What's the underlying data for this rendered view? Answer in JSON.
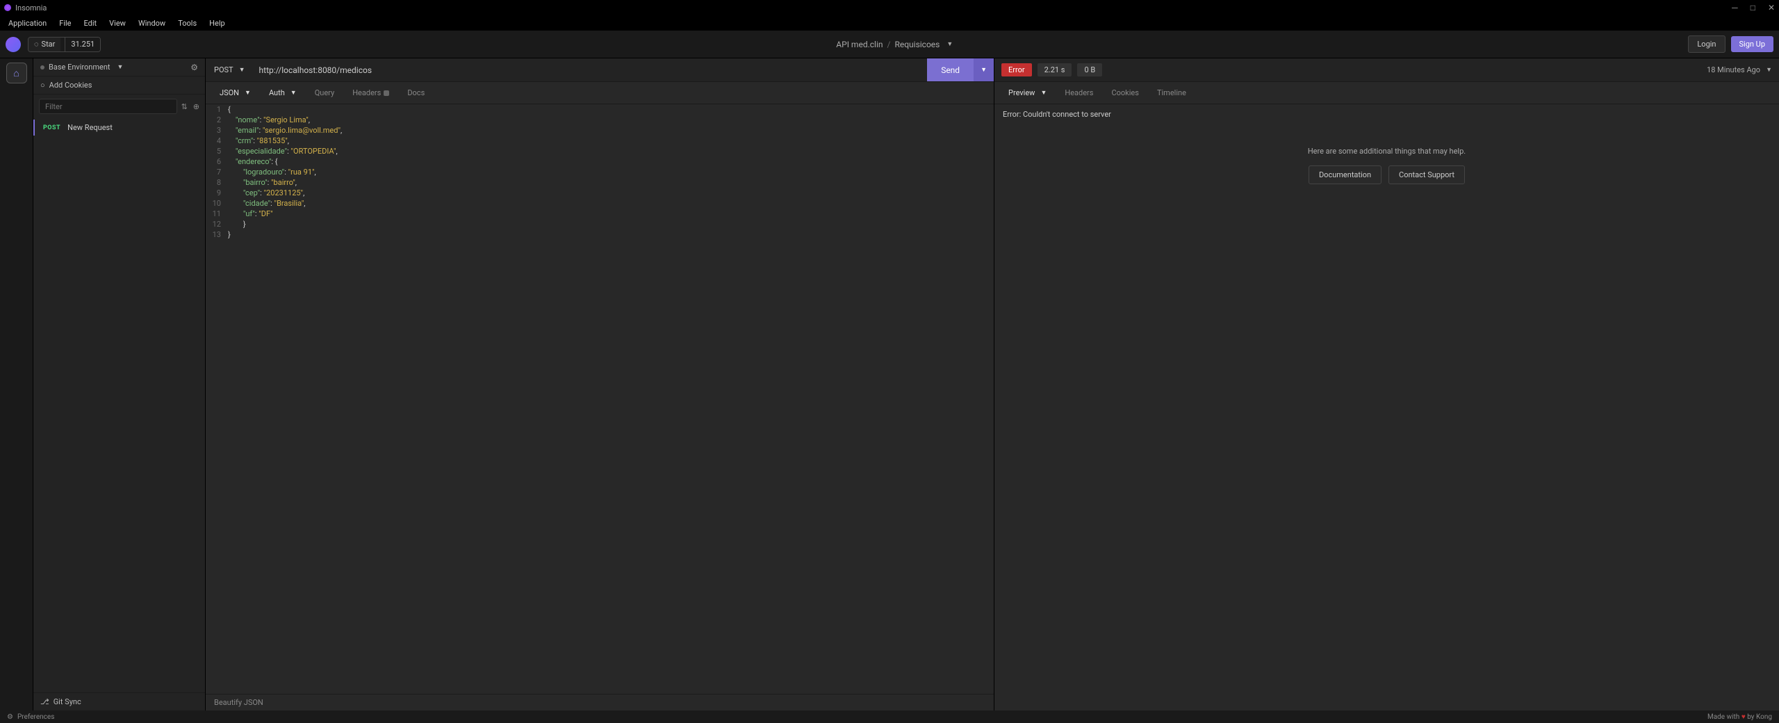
{
  "app": {
    "title": "Insomnia"
  },
  "menubar": [
    "Application",
    "File",
    "Edit",
    "View",
    "Window",
    "Tools",
    "Help"
  ],
  "toolbar": {
    "star_label": "Star",
    "star_count": "31.251",
    "project": "API med.clin",
    "collection": "Requisicoes",
    "login": "Login",
    "signup": "Sign Up"
  },
  "sidebar": {
    "environment": "Base Environment",
    "add_cookies": "Add Cookies",
    "filter_placeholder": "Filter",
    "requests": [
      {
        "method": "POST",
        "name": "New Request"
      }
    ],
    "git_sync": "Git Sync"
  },
  "request": {
    "method": "POST",
    "url": "http://localhost:8080/medicos",
    "send": "Send",
    "tabs": {
      "body": "JSON",
      "auth": "Auth",
      "query": "Query",
      "headers": "Headers",
      "docs": "Docs"
    },
    "editor_lines": [
      {
        "n": 1,
        "tokens": [
          {
            "t": "punct",
            "v": "{"
          }
        ]
      },
      {
        "n": 2,
        "tokens": [
          {
            "t": "indent",
            "v": "    "
          },
          {
            "t": "key",
            "v": "\"nome\""
          },
          {
            "t": "punct",
            "v": ": "
          },
          {
            "t": "string",
            "v": "\"Sergio Lima\""
          },
          {
            "t": "punct",
            "v": ","
          }
        ]
      },
      {
        "n": 3,
        "tokens": [
          {
            "t": "indent",
            "v": "    "
          },
          {
            "t": "key",
            "v": "\"email\""
          },
          {
            "t": "punct",
            "v": ": "
          },
          {
            "t": "string",
            "v": "\"sergio.lima@voll.med\""
          },
          {
            "t": "punct",
            "v": ","
          }
        ]
      },
      {
        "n": 4,
        "tokens": [
          {
            "t": "indent",
            "v": "    "
          },
          {
            "t": "key",
            "v": "\"crm\""
          },
          {
            "t": "punct",
            "v": ": "
          },
          {
            "t": "string",
            "v": "\"881535\""
          },
          {
            "t": "punct",
            "v": ","
          }
        ]
      },
      {
        "n": 5,
        "tokens": [
          {
            "t": "indent",
            "v": "    "
          },
          {
            "t": "key",
            "v": "\"especialidade\""
          },
          {
            "t": "punct",
            "v": ": "
          },
          {
            "t": "string",
            "v": "\"ORTOPEDIA\""
          },
          {
            "t": "punct",
            "v": ","
          }
        ]
      },
      {
        "n": 6,
        "tokens": [
          {
            "t": "indent",
            "v": "    "
          },
          {
            "t": "key",
            "v": "\"endereco\""
          },
          {
            "t": "punct",
            "v": ": {"
          }
        ]
      },
      {
        "n": 7,
        "tokens": [
          {
            "t": "indent",
            "v": "        "
          },
          {
            "t": "key",
            "v": "\"logradouro\""
          },
          {
            "t": "punct",
            "v": ": "
          },
          {
            "t": "string",
            "v": "\"rua 91\""
          },
          {
            "t": "punct",
            "v": ","
          }
        ]
      },
      {
        "n": 8,
        "tokens": [
          {
            "t": "indent",
            "v": "        "
          },
          {
            "t": "key",
            "v": "\"bairro\""
          },
          {
            "t": "punct",
            "v": ": "
          },
          {
            "t": "string",
            "v": "\"bairro\""
          },
          {
            "t": "punct",
            "v": ","
          }
        ]
      },
      {
        "n": 9,
        "tokens": [
          {
            "t": "indent",
            "v": "        "
          },
          {
            "t": "key",
            "v": "\"cep\""
          },
          {
            "t": "punct",
            "v": ": "
          },
          {
            "t": "string",
            "v": "\"20231125\""
          },
          {
            "t": "punct",
            "v": ","
          }
        ]
      },
      {
        "n": 10,
        "tokens": [
          {
            "t": "indent",
            "v": "        "
          },
          {
            "t": "key",
            "v": "\"cidade\""
          },
          {
            "t": "punct",
            "v": ": "
          },
          {
            "t": "string",
            "v": "\"Brasilia\""
          },
          {
            "t": "punct",
            "v": ","
          }
        ]
      },
      {
        "n": 11,
        "tokens": [
          {
            "t": "indent",
            "v": "        "
          },
          {
            "t": "key",
            "v": "\"uf\""
          },
          {
            "t": "punct",
            "v": ": "
          },
          {
            "t": "string",
            "v": "\"DF\""
          }
        ]
      },
      {
        "n": 12,
        "tokens": [
          {
            "t": "indent",
            "v": "        "
          },
          {
            "t": "punct",
            "v": "}"
          }
        ]
      },
      {
        "n": 13,
        "tokens": [
          {
            "t": "punct",
            "v": "}"
          }
        ]
      }
    ],
    "beautify": "Beautify JSON"
  },
  "response": {
    "status": "Error",
    "time": "2.21 s",
    "size": "0 B",
    "history": "18 Minutes Ago",
    "tabs": [
      "Preview",
      "Headers",
      "Cookies",
      "Timeline"
    ],
    "error_text": "Error: Couldn't connect to server",
    "help_text": "Here are some additional things that may help.",
    "help_docs": "Documentation",
    "help_support": "Contact Support"
  },
  "statusbar": {
    "preferences": "Preferences",
    "made_with": "Made with ",
    "by_kong": " by Kong"
  }
}
